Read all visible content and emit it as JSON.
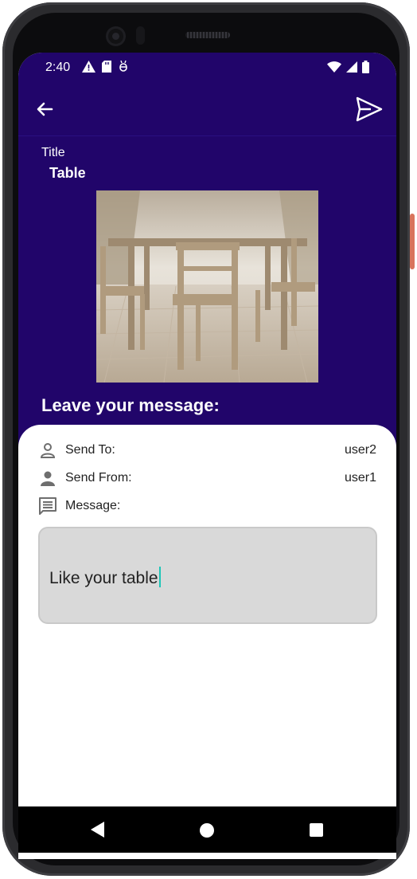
{
  "status_bar": {
    "time": "2:40",
    "icons": [
      "warning-icon",
      "sd-card-icon",
      "debug-icon"
    ],
    "right_icons": [
      "wifi-icon",
      "signal-icon",
      "battery-icon"
    ]
  },
  "app_bar": {
    "back_icon": "arrow-back-icon",
    "send_icon": "send-icon"
  },
  "item": {
    "title_label": "Title",
    "title_value": "Table",
    "image": "photo of a wooden table with chairs"
  },
  "heading": "Leave your message:",
  "form": {
    "send_to_label": "Send To:",
    "send_to_value": "user2",
    "send_from_label": "Send From:",
    "send_from_value": "user1",
    "message_label": "Message:",
    "message_value": "Like your table"
  },
  "nav_bar": {
    "buttons": [
      "back-triangle",
      "home-circle",
      "recents-square"
    ]
  },
  "colors": {
    "primary": "#21056A",
    "input_bg": "#D9D9D9",
    "caret": "#1DC6B8"
  }
}
